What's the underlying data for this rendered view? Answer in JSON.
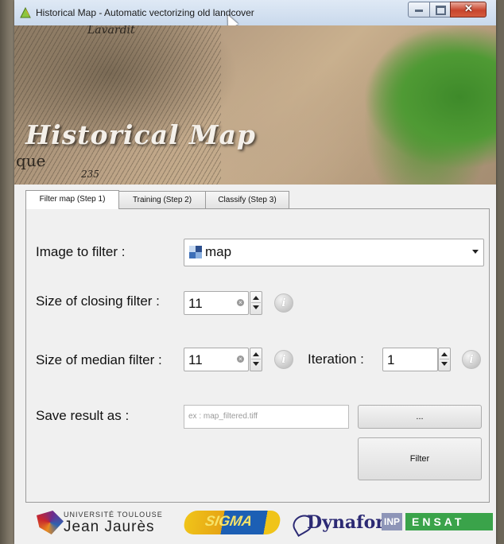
{
  "window": {
    "title": "Historical Map - Automatic vectorizing old landcover"
  },
  "banner": {
    "title": "Historical Map",
    "map_text_top": "Lavardit",
    "map_text_left": "que",
    "map_text_num": "235"
  },
  "tabs": [
    {
      "label": "Filter map (Step 1)",
      "active": true
    },
    {
      "label": "Training (Step 2)",
      "active": false
    },
    {
      "label": "Classify (Step 3)",
      "active": false
    }
  ],
  "form": {
    "image_label": "Image to filter :",
    "image_value": "map",
    "closing_label": "Size of closing filter :",
    "closing_value": "11",
    "median_label": "Size of median filter :",
    "median_value": "11",
    "iteration_label": "Iteration :",
    "iteration_value": "1",
    "save_label": "Save result as :",
    "save_placeholder": "ex : map_filtered.tiff",
    "browse_label": "...",
    "filter_label": "Filter",
    "info_glyph": "i"
  },
  "footer": {
    "ut_small": "UNIVERSITÉ TOULOUSE",
    "ut_big": "Jean Jaurès",
    "sigma": "SIGMA",
    "dynafor": "Dynafor",
    "inp": "INP",
    "ensat": "ENSAT"
  },
  "colors": {
    "close_button": "#c8452d",
    "forest_green": "#4f9a34",
    "ensat_green": "#3aa34a"
  }
}
